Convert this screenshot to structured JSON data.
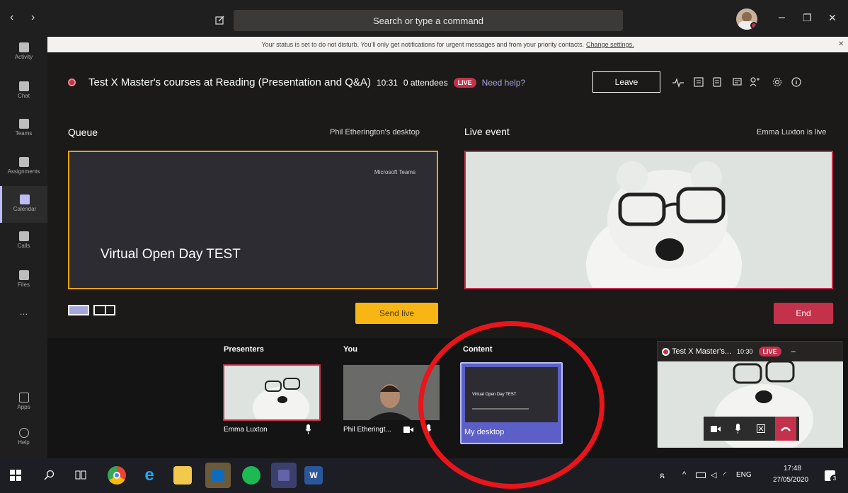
{
  "window": {
    "search_placeholder": "Search or type a command",
    "back": "‹",
    "forward": "›",
    "minimize": "–",
    "maximize": "❐",
    "close": "✕"
  },
  "notification": {
    "text": "Your status is set to do not disturb. You'll only get notifications for urgent messages and from your priority contacts.",
    "link": "Change settings.",
    "close": "✕"
  },
  "rail": {
    "items": [
      {
        "label": "Activity"
      },
      {
        "label": "Chat"
      },
      {
        "label": "Teams"
      },
      {
        "label": "Assignments"
      },
      {
        "label": "Calendar"
      },
      {
        "label": "Calls"
      },
      {
        "label": "Files"
      },
      {
        "label": "..."
      },
      {
        "label": "Apps"
      },
      {
        "label": "Help"
      }
    ]
  },
  "event": {
    "title": "Test X Master's courses at Reading (Presentation and Q&A)",
    "time": "10:31",
    "attendees": "0 attendees",
    "live": "LIVE",
    "help": "Need help?",
    "leave": "Leave"
  },
  "queue": {
    "heading": "Queue",
    "source": "Phil Etherington's desktop",
    "slide_brand": "Microsoft Teams",
    "slide_title": "Virtual Open Day TEST",
    "send_live": "Send live"
  },
  "live_event": {
    "heading": "Live event",
    "status": "Emma Luxton is live",
    "end": "End"
  },
  "strip": {
    "presenters_heading": "Presenters",
    "you_heading": "You",
    "content_heading": "Content",
    "presenter_name": "Emma Luxton",
    "you_name": "Phil Etheringt...",
    "content_name": "My desktop",
    "content_slide_title": "Virtual Open Day TEST"
  },
  "mini_player": {
    "title": "Test X Master's...",
    "time": "10:30",
    "live": "LIVE"
  },
  "taskbar": {
    "lang": "ENG",
    "time": "17:48",
    "date": "27/05/2020",
    "notifications": "3"
  },
  "colors": {
    "accent": "#6264a7",
    "live": "#c4314b",
    "send": "#f8b614",
    "annotation": "#e8151b"
  }
}
